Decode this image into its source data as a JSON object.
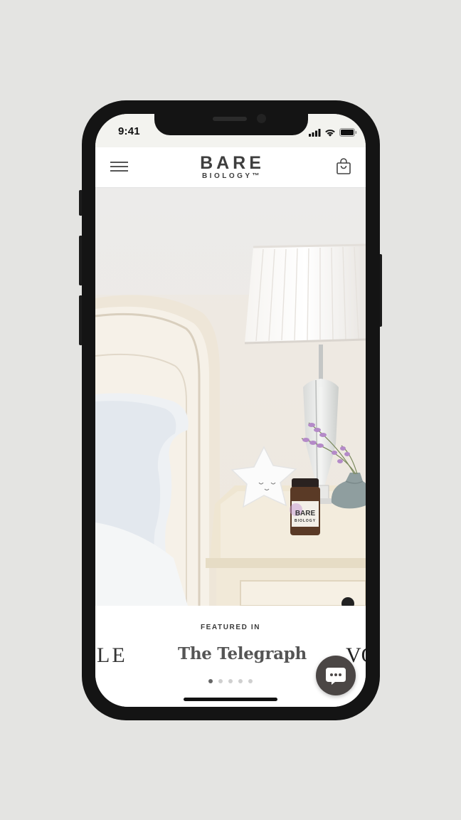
{
  "status_bar": {
    "time": "9:41",
    "icons": [
      "signal-icon",
      "wifi-icon",
      "battery-icon"
    ]
  },
  "header": {
    "menu_icon": "hamburger-menu-icon",
    "brand_main": "BARE",
    "brand_sub": "BIOLOGY™",
    "cart_icon": "shopping-bag-icon"
  },
  "hero": {
    "product_label_main": "BARE",
    "product_label_sub": "BIOLOGY"
  },
  "featured": {
    "label": "FEATURED IN",
    "publications": [
      "LE",
      "The Telegraph",
      "VO"
    ],
    "slide_count": 5,
    "active_slide": 1
  },
  "chat": {
    "icon": "chat-bubble-icon"
  },
  "colors": {
    "page_background": "#e4e4e2",
    "phone_frame": "#141414",
    "status_bar": "#f3f3ef",
    "brand_text": "#3e3e3e",
    "chat_button": "#4b4645",
    "dot_active": "#666666",
    "dot_inactive": "#cfcfcf"
  }
}
